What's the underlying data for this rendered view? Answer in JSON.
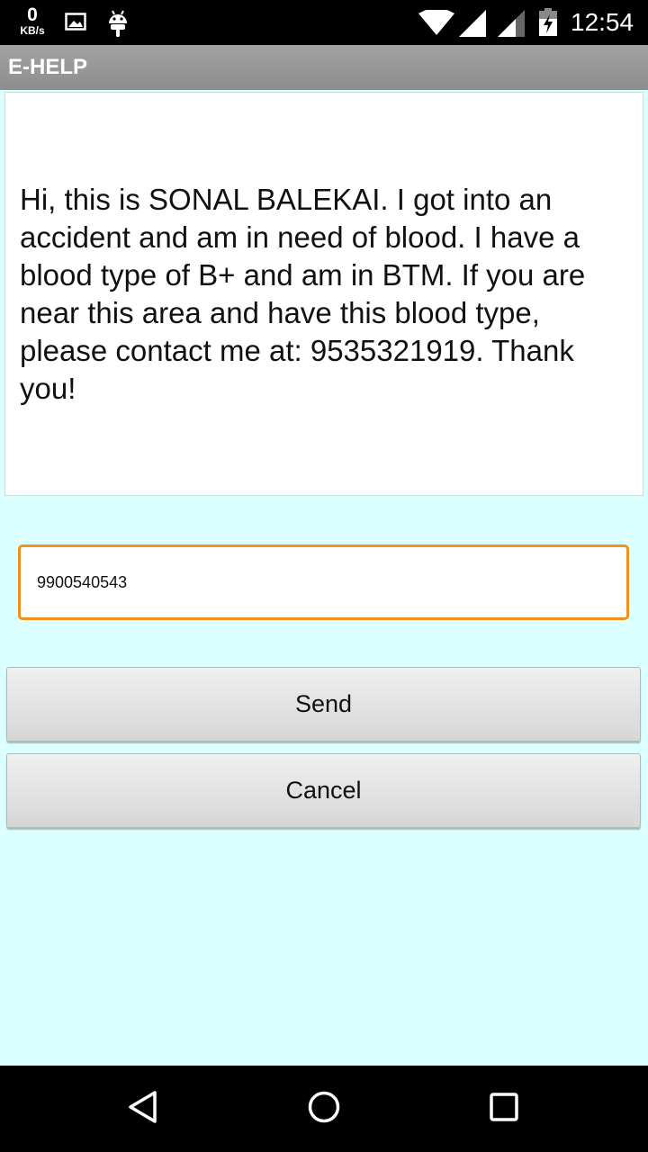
{
  "status_bar": {
    "net_speed_value": "0",
    "net_speed_unit": "KB/s",
    "time": "12:54",
    "icons": [
      "image-icon",
      "android-icon",
      "wifi-icon",
      "signal-icon",
      "signal-icon",
      "battery-charging-icon"
    ]
  },
  "app_bar": {
    "title": "E-HELP"
  },
  "message": {
    "text": "Hi, this is SONAL BALEKAI. I got into an accident and am in need of blood. I have a blood type of B+ and am in BTM. If you are near this area and have this blood type, please contact me at: 9535321919. Thank you!"
  },
  "phone_field": {
    "value": "9900540543"
  },
  "buttons": {
    "send": "Send",
    "cancel": "Cancel"
  },
  "nav_bar": {
    "icons": [
      "back-icon",
      "home-icon",
      "recents-icon"
    ]
  },
  "colors": {
    "background": "#dcffff",
    "app_bar": "#969696",
    "input_focus_border": "#f39018",
    "status_bar": "#000000"
  }
}
